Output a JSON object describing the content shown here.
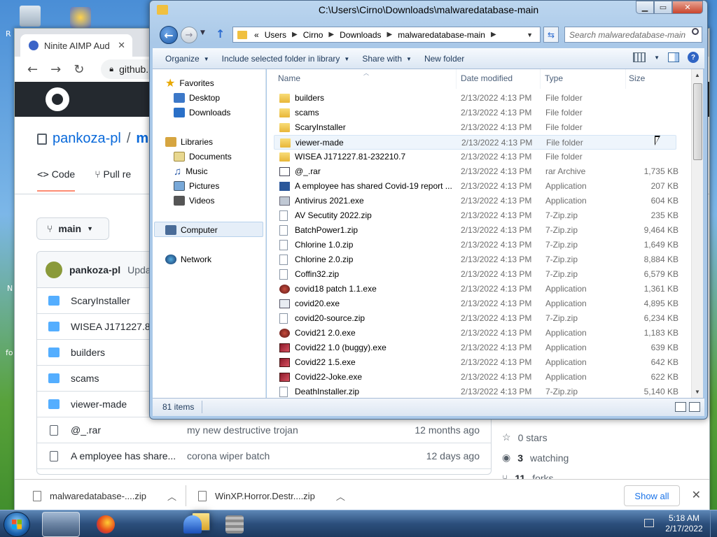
{
  "desktop": {
    "labels": [
      "R",
      "fo",
      "N"
    ]
  },
  "browser": {
    "tab_title": "Ninite AIMP Aud",
    "url": "github.",
    "repo_owner": "pankoza-pl",
    "repo_sep": "/",
    "repo_name": "ma",
    "tabs": [
      {
        "label": "Code"
      },
      {
        "label": "Pull re"
      }
    ],
    "branch": "main",
    "commit_user": "pankoza-pl",
    "commit_msg": "Upda",
    "files": [
      {
        "name": "ScaryInstaller",
        "type": "folder",
        "commit": "",
        "time": ""
      },
      {
        "name": "WISEA J171227.81",
        "type": "folder",
        "commit": "",
        "time": ""
      },
      {
        "name": "builders",
        "type": "folder",
        "commit": "",
        "time": ""
      },
      {
        "name": "scams",
        "type": "folder",
        "commit": "",
        "time": ""
      },
      {
        "name": "viewer-made",
        "type": "folder",
        "commit": "",
        "time": ""
      },
      {
        "name": "@_.rar",
        "type": "file",
        "commit": "my new destructive trojan",
        "time": "12 months ago"
      },
      {
        "name": "A employee has share...",
        "type": "file",
        "commit": "corona wiper batch",
        "time": "12 days ago"
      }
    ],
    "sidebar": {
      "stars": "0 stars",
      "watching_count": "3",
      "watching_label": "watching",
      "forks_count": "11",
      "forks_label": "forks"
    },
    "downloads": [
      {
        "name": "malwaredatabase-....zip"
      },
      {
        "name": "WinXP.Horror.Destr....zip"
      }
    ],
    "show_all": "Show all"
  },
  "explorer": {
    "title": "C:\\Users\\Cirno\\Downloads\\malwaredatabase-main",
    "address": {
      "prefix": "«",
      "crumbs": [
        "Users",
        "Cirno",
        "Downloads",
        "malwaredatabase-main"
      ]
    },
    "search_placeholder": "Search malwaredatabase-main",
    "commands": {
      "organize": "Organize",
      "include": "Include selected folder in library",
      "share": "Share with",
      "new_folder": "New folder"
    },
    "nav": {
      "favorites": "Favorites",
      "desktop": "Desktop",
      "downloads": "Downloads",
      "libraries": "Libraries",
      "documents": "Documents",
      "music": "Music",
      "pictures": "Pictures",
      "videos": "Videos",
      "computer": "Computer",
      "network": "Network"
    },
    "columns": {
      "name": "Name",
      "date": "Date modified",
      "type": "Type",
      "size": "Size"
    },
    "files": [
      {
        "name": "builders",
        "date": "2/13/2022 4:13 PM",
        "type": "File folder",
        "size": "",
        "icon": "folder"
      },
      {
        "name": "scams",
        "date": "2/13/2022 4:13 PM",
        "type": "File folder",
        "size": "",
        "icon": "folder"
      },
      {
        "name": "ScaryInstaller",
        "date": "2/13/2022 4:13 PM",
        "type": "File folder",
        "size": "",
        "icon": "folder"
      },
      {
        "name": "viewer-made",
        "date": "2/13/2022 4:13 PM",
        "type": "File folder",
        "size": "",
        "icon": "folder"
      },
      {
        "name": "WISEA J171227.81-232210.7",
        "date": "2/13/2022 4:13 PM",
        "type": "File folder",
        "size": "",
        "icon": "folder"
      },
      {
        "name": "@_.rar",
        "date": "2/13/2022 4:13 PM",
        "type": "rar Archive",
        "size": "1,735 KB",
        "icon": "rar"
      },
      {
        "name": "A employee has shared Covid-19 report ...",
        "date": "2/13/2022 4:13 PM",
        "type": "Application",
        "size": "207 KB",
        "icon": "word"
      },
      {
        "name": "Antivirus 2021.exe",
        "date": "2/13/2022 4:13 PM",
        "type": "Application",
        "size": "604 KB",
        "icon": "app"
      },
      {
        "name": "AV Secutity 2022.zip",
        "date": "2/13/2022 4:13 PM",
        "type": "7-Zip.zip",
        "size": "235 KB",
        "icon": "zip"
      },
      {
        "name": "BatchPower1.zip",
        "date": "2/13/2022 4:13 PM",
        "type": "7-Zip.zip",
        "size": "9,464 KB",
        "icon": "zip"
      },
      {
        "name": "Chlorine 1.0.zip",
        "date": "2/13/2022 4:13 PM",
        "type": "7-Zip.zip",
        "size": "1,649 KB",
        "icon": "zip"
      },
      {
        "name": "Chlorine 2.0.zip",
        "date": "2/13/2022 4:13 PM",
        "type": "7-Zip.zip",
        "size": "8,884 KB",
        "icon": "zip"
      },
      {
        "name": "Coffin32.zip",
        "date": "2/13/2022 4:13 PM",
        "type": "7-Zip.zip",
        "size": "6,579 KB",
        "icon": "zip"
      },
      {
        "name": "covid18 patch 1.1.exe",
        "date": "2/13/2022 4:13 PM",
        "type": "Application",
        "size": "1,361 KB",
        "icon": "bug"
      },
      {
        "name": "covid20.exe",
        "date": "2/13/2022 4:13 PM",
        "type": "Application",
        "size": "4,895 KB",
        "icon": "win"
      },
      {
        "name": "covid20-source.zip",
        "date": "2/13/2022 4:13 PM",
        "type": "7-Zip.zip",
        "size": "6,234 KB",
        "icon": "zip"
      },
      {
        "name": "Covid21 2.0.exe",
        "date": "2/13/2022 4:13 PM",
        "type": "Application",
        "size": "1,183 KB",
        "icon": "bug"
      },
      {
        "name": "Covid22 1.0 (buggy).exe",
        "date": "2/13/2022 4:13 PM",
        "type": "Application",
        "size": "639 KB",
        "icon": "red"
      },
      {
        "name": "Covid22 1.5.exe",
        "date": "2/13/2022 4:13 PM",
        "type": "Application",
        "size": "642 KB",
        "icon": "red"
      },
      {
        "name": "Covid22-Joke.exe",
        "date": "2/13/2022 4:13 PM",
        "type": "Application",
        "size": "622 KB",
        "icon": "red"
      },
      {
        "name": "DeathInstaller.zip",
        "date": "2/13/2022 4:13 PM",
        "type": "7-Zip.zip",
        "size": "5,140 KB",
        "icon": "zip"
      }
    ],
    "hovered_index": 3,
    "status_count": "81 items"
  },
  "taskbar": {
    "time": "5:18 AM",
    "date": "2/17/2022",
    "apps": [
      {
        "name": "Windows Explorer",
        "icon": "explorer",
        "active": true
      },
      {
        "name": "Firefox",
        "icon": "firefox",
        "active": false
      },
      {
        "name": "Google Chrome",
        "icon": "chrome",
        "active": false
      },
      {
        "name": "AIMP",
        "icon": "aimp",
        "active": false
      },
      {
        "name": "WinRAR",
        "icon": "winrar",
        "active": false
      }
    ]
  }
}
